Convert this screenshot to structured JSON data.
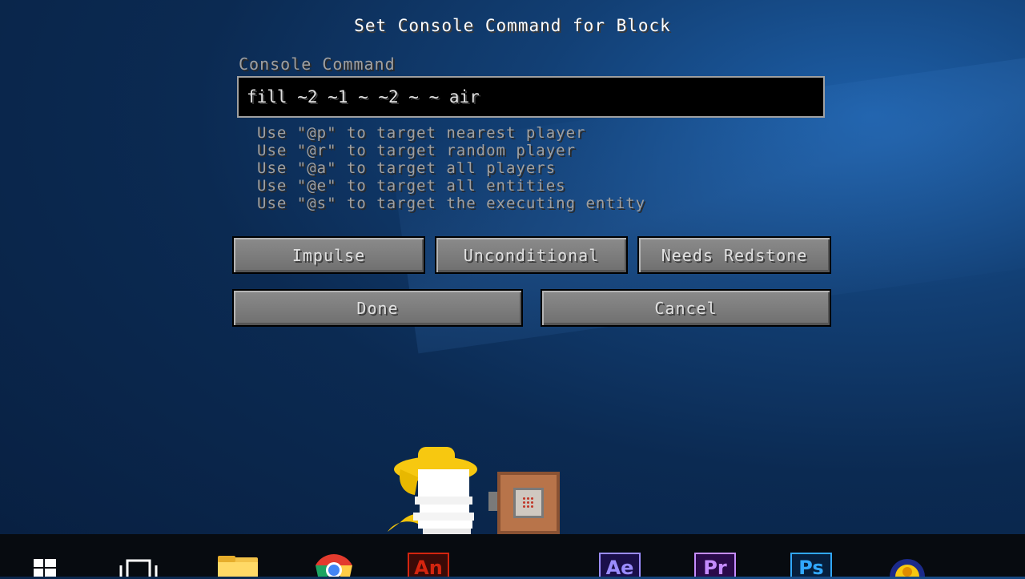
{
  "window": {
    "title": "Set Console Command for Block"
  },
  "command": {
    "label": "Console Command",
    "value": "fill ~2 ~1 ~ ~2 ~ ~ air"
  },
  "hints": [
    "Use \"@p\" to target nearest player",
    "Use \"@r\" to target random player",
    "Use \"@a\" to target all players",
    "Use \"@e\" to target all entities",
    "Use \"@s\" to target the executing entity"
  ],
  "buttons": {
    "mode": "Impulse",
    "condition": "Unconditional",
    "redstone": "Needs Redstone",
    "done": "Done",
    "cancel": "Cancel"
  },
  "taskbar": {
    "apps": [
      {
        "name": "start",
        "icon": "windows-logo-icon"
      },
      {
        "name": "task-view",
        "icon": "task-view-icon"
      },
      {
        "name": "file-explorer",
        "icon": "folder-icon"
      },
      {
        "name": "chrome",
        "icon": "chrome-icon"
      },
      {
        "name": "animate",
        "icon": "animate-icon",
        "label": "An",
        "color": "#d4250f"
      },
      {
        "name": "after-effects",
        "icon": "after-effects-icon",
        "label": "Ae",
        "color": "#9a8cff"
      },
      {
        "name": "premiere",
        "icon": "premiere-icon",
        "label": "Pr",
        "color": "#c58cff"
      },
      {
        "name": "photoshop",
        "icon": "photoshop-icon",
        "label": "Ps",
        "color": "#31a8ff"
      },
      {
        "name": "app",
        "icon": "app-avatar-icon"
      }
    ]
  }
}
